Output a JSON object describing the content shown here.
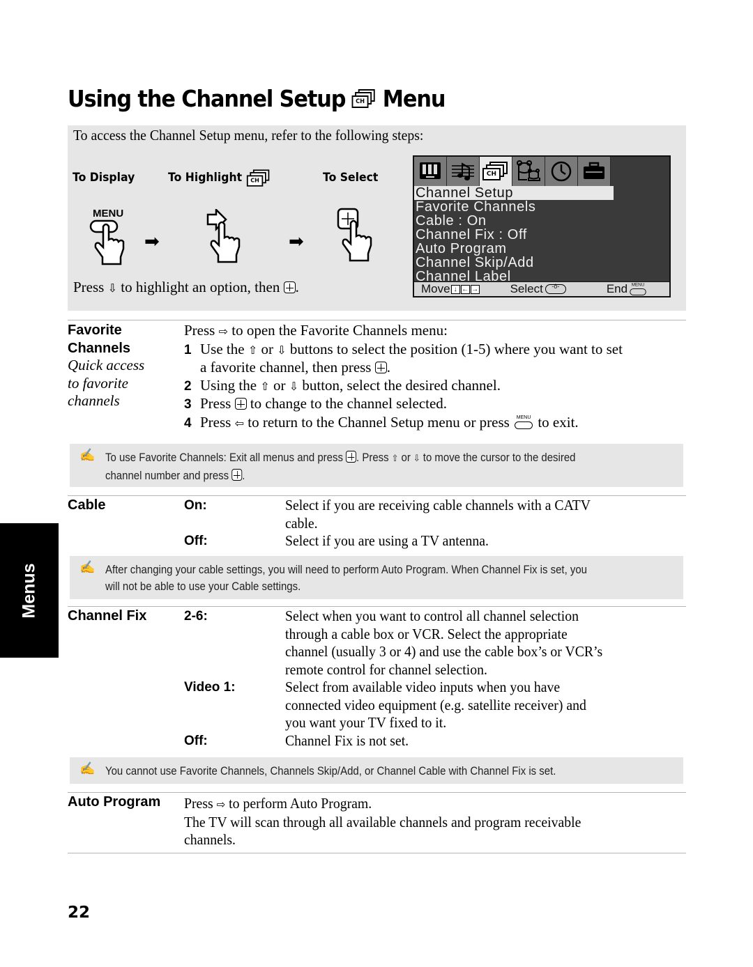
{
  "title": {
    "before": "Using the Channel Setup",
    "icon_text": "CH",
    "after": "Menu"
  },
  "intro": {
    "text": "To access the Channel Setup menu, refer to the following steps:",
    "steps": [
      {
        "label": "To Display",
        "button": "MENU"
      },
      {
        "label": "To Highlight"
      },
      {
        "label": "To Select"
      }
    ],
    "hint": {
      "part1": "Press",
      "part2": "to highlight an option, then",
      "part3": "."
    }
  },
  "osd": {
    "tabs": [
      "picture",
      "audio",
      "channel",
      "parent",
      "timer",
      "setup"
    ],
    "active_tab": "channel",
    "tab_icon_text": "CH",
    "items": [
      "Channel Setup",
      "Favorite Channels",
      "Cable : On",
      "Channel Fix : Off",
      "Auto Program",
      "Channel Skip/Add",
      "Channel Label"
    ],
    "bar": {
      "move": "Move",
      "select": "Select",
      "end": "End",
      "end_key": "MENU"
    }
  },
  "favorite": {
    "title_line1": "Favorite",
    "title_line2": "Channels",
    "subtitle": [
      "Quick access",
      "to favorite",
      "channels"
    ],
    "intro_a": "Press",
    "intro_b": "to open the Favorite Channels menu:",
    "steps": [
      {
        "num": "1",
        "a": "Use the",
        "b": "or",
        "c": "buttons to select the position (1-5) where you want to set",
        "line2a": "a favorite channel, then press",
        "line2b": "."
      },
      {
        "num": "2",
        "a": "Using the",
        "b": "or",
        "c": "button, select the desired channel."
      },
      {
        "num": "3",
        "a": "Press",
        "b": "to change to the channel selected."
      },
      {
        "num": "4",
        "a": "Press",
        "b": "to return to the Channel Setup menu or press",
        "c": "to exit.",
        "key": "MENU"
      }
    ],
    "note": {
      "a": "To use Favorite Channels: Exit all menus and press",
      "b": ". Press",
      "c": "or",
      "d": "to move the cursor to the desired",
      "e": "channel number and press",
      "f": "."
    }
  },
  "cable": {
    "title": "Cable",
    "options": [
      {
        "label": "On:",
        "desc_line1": "Select if you are receiving cable channels with a CATV",
        "desc_line2": "cable."
      },
      {
        "label": "Off:",
        "desc_line1": "Select if you are using a TV antenna."
      }
    ],
    "note": {
      "line1": "After changing your cable settings, you will need to perform Auto Program. When Channel Fix is set, you",
      "line2": "will not be able to use your Cable settings."
    }
  },
  "channel_fix": {
    "title": "Channel Fix",
    "options": [
      {
        "label": "2-6:",
        "lines": [
          "Select when you want to control all channel selection",
          "through a cable box or VCR. Select the appropriate",
          "channel (usually 3 or 4) and use the cable box’s or VCR’s",
          "remote control for channel selection."
        ]
      },
      {
        "label": "Video 1:",
        "lines": [
          "Select from available video inputs when you have",
          "connected video equipment (e.g. satellite receiver) and",
          "you want your TV fixed to it."
        ]
      },
      {
        "label": "Off:",
        "lines": [
          "Channel Fix is not set."
        ]
      }
    ],
    "note": "You cannot use Favorite Channels, Channels Skip/Add, or Channel Cable with Channel Fix is set."
  },
  "auto_program": {
    "title": "Auto Program",
    "line1a": "Press",
    "line1b": "to perform Auto Program.",
    "line2": "The TV will scan through all available channels and program receivable",
    "line3": "channels."
  },
  "side_tab": "Menus",
  "page_number": "22",
  "icons": {
    "up": "⇧",
    "down": "⇩",
    "left": "⇦",
    "right": "⇨",
    "note": "✍",
    "arrow_step": "➡",
    "k_down": "↓",
    "k_left": "←",
    "k_right": "→"
  }
}
